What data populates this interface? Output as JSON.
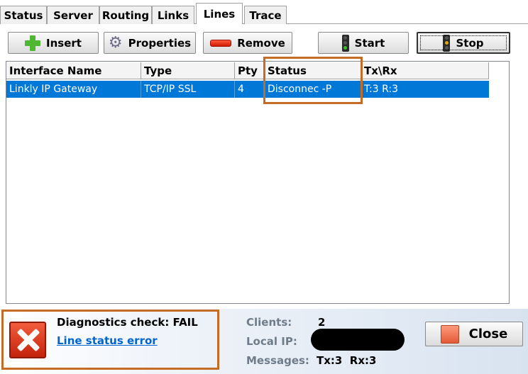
{
  "tabs": [
    {
      "label": "Status"
    },
    {
      "label": "Server"
    },
    {
      "label": "Routing"
    },
    {
      "label": "Links"
    },
    {
      "label": "Lines",
      "active": true
    },
    {
      "label": "Trace"
    }
  ],
  "toolbar": {
    "insert_label": "Insert",
    "properties_label": "Properties",
    "remove_label": "Remove",
    "start_label": "Start",
    "stop_label": "Stop"
  },
  "table": {
    "columns": [
      "Interface Name",
      "Type",
      "Pty",
      "Status",
      "Tx\\Rx"
    ],
    "rows": [
      [
        "Linkly IP Gateway",
        "TCP/IP SSL",
        "4",
        "Disconnec -P",
        "T:3 R:3"
      ]
    ]
  },
  "diagnostics": {
    "title": "Diagnostics check: FAIL",
    "link": "Line status error"
  },
  "info": {
    "clients_label": "Clients:",
    "clients_value": "2",
    "local_ip_label": "Local IP:",
    "messages_label": "Messages:",
    "messages_value": "Tx:3  Rx:3"
  },
  "close_label": "Close",
  "colors": {
    "selection": "#0078d7",
    "highlight_box": "#c46c26",
    "link": "#0066cc",
    "error": "#d83a1a"
  }
}
